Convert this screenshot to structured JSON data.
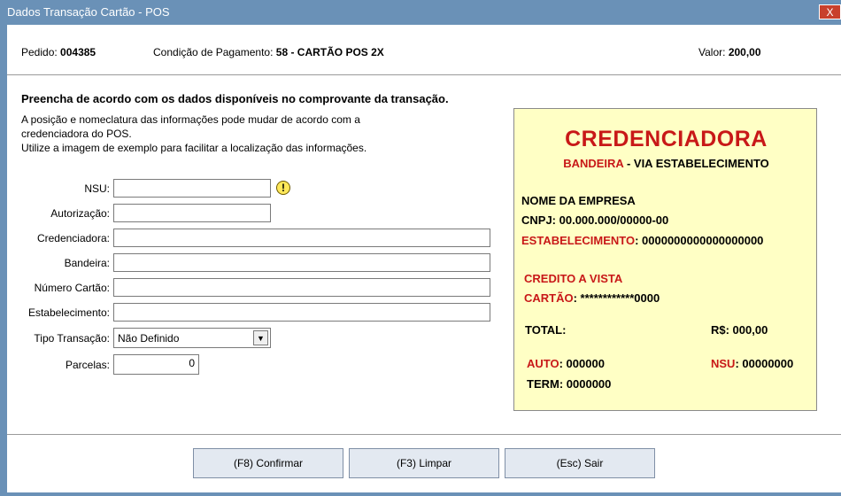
{
  "window": {
    "title": "Dados Transação Cartão - POS",
    "close": "X"
  },
  "header": {
    "pedido_label": "Pedido:",
    "pedido_value": "004385",
    "condicao_label": "Condição de Pagamento:",
    "condicao_value": "58 - CARTÃO POS 2X",
    "valor_label": "Valor:",
    "valor_value": "200,00"
  },
  "instructions": {
    "heading": "Preencha de acordo com os dados disponíveis no comprovante da transação.",
    "line1": "A posição e nomeclatura das informações pode mudar de acordo com a",
    "line2": "credenciadora do POS.",
    "line3": "Utilize a imagem de exemplo para facilitar a localização das informações."
  },
  "form": {
    "nsu_label": "NSU:",
    "nsu_value": "",
    "autorizacao_label": "Autorização:",
    "autorizacao_value": "",
    "credenciadora_label": "Credenciadora:",
    "credenciadora_value": "",
    "bandeira_label": "Bandeira:",
    "bandeira_value": "",
    "numero_cartao_label": "Número Cartão:",
    "numero_cartao_value": "",
    "estabelecimento_label": "Estabelecimento:",
    "estabelecimento_value": "",
    "tipo_transacao_label": "Tipo Transação:",
    "tipo_transacao_value": "Não Definido",
    "parcelas_label": "Parcelas:",
    "parcelas_value": "0"
  },
  "receipt": {
    "title": "CREDENCIADORA",
    "bandeira": "BANDEIRA",
    "via": " - VIA ESTABELECIMENTO",
    "empresa": "NOME DA EMPRESA",
    "cnpj": "CNPJ: 00.000.000/00000-00",
    "estab_label": "ESTABELECIMENTO",
    "estab_value": ": 0000000000000000000",
    "credito": "CREDITO A VISTA",
    "cartao_label": "CARTÃO",
    "cartao_value": ": ************0000",
    "total_label": "TOTAL:",
    "total_value": "R$: 000,00",
    "auto_label": "AUTO",
    "auto_value": ": 000000",
    "nsu_label": "NSU",
    "nsu_value": ": 00000000",
    "term": "TERM: 0000000",
    "colors": {
      "accent": "#c81818",
      "background": "#ffffc5"
    }
  },
  "buttons": {
    "confirmar": "(F8) Confirmar",
    "limpar": "(F3) Limpar",
    "sair": "(Esc) Sair"
  },
  "colors": {
    "titlebar": "#6a91b7",
    "close": "#c8402c",
    "button": "#e3e9f1"
  }
}
